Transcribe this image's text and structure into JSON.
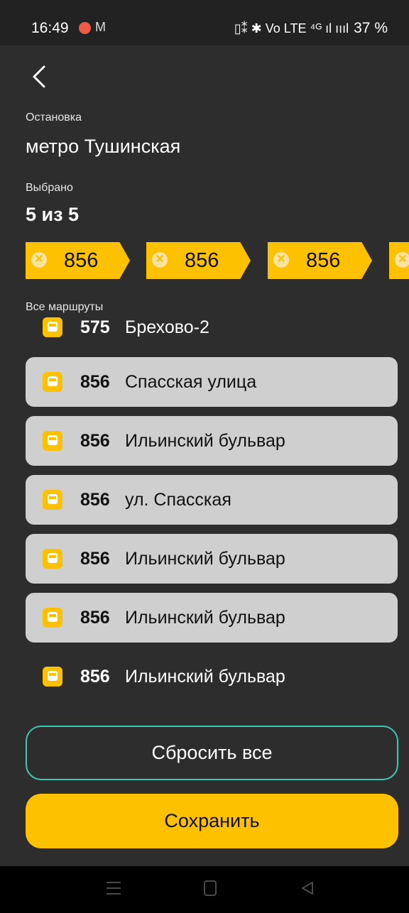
{
  "status_bar": {
    "time": "16:49",
    "mail_icon": "gmail-icon",
    "right_icons": "▯⁑ ✱ Vo LTE ⁴ᴳ ıl ıııl",
    "battery": "37 %"
  },
  "header": {
    "back_icon": "back-chevron-icon"
  },
  "stop": {
    "label": "Остановка",
    "name": "метро Тушинская"
  },
  "selected": {
    "label": "Выбрано",
    "count": "5 из 5"
  },
  "chips": [
    {
      "route": "856"
    },
    {
      "route": "856"
    },
    {
      "route": "856"
    },
    {
      "route": ""
    }
  ],
  "all_routes": {
    "label": "Все маршруты",
    "items": [
      {
        "number": "575",
        "name": "Брехово-2",
        "selected": false
      },
      {
        "number": "856",
        "name": "Спасская улица",
        "selected": true
      },
      {
        "number": "856",
        "name": "Ильинский бульвар",
        "selected": true
      },
      {
        "number": "856",
        "name": "ул. Спасская",
        "selected": true
      },
      {
        "number": "856",
        "name": "Ильинский бульвар",
        "selected": true
      },
      {
        "number": "856",
        "name": "Ильинский бульвар",
        "selected": true
      },
      {
        "number": "856",
        "name": "Ильинский бульвар",
        "selected": false
      }
    ]
  },
  "buttons": {
    "reset": "Сбросить все",
    "save": "Сохранить"
  },
  "colors": {
    "accent": "#fdc100",
    "outline": "#3cc9b0",
    "background": "#2d2d2d"
  }
}
